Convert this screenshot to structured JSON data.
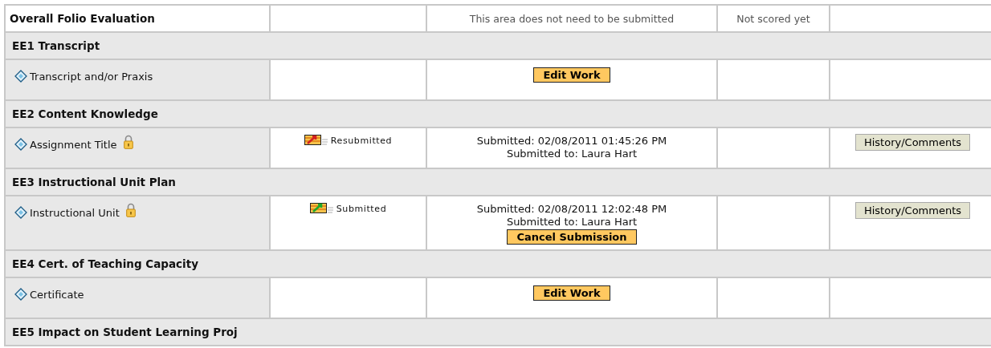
{
  "summary": {
    "title": "Overall Folio Evaluation",
    "status": "This area does not need to be submitted",
    "score": "Not scored yet"
  },
  "sections": [
    {
      "title": "EE1 Transcript",
      "items": [
        {
          "name": "Transcript and/or Praxis",
          "locked": false,
          "work": {
            "button": {
              "label": "Edit Work"
            }
          }
        }
      ]
    },
    {
      "title": "EE2 Content Knowledge",
      "items": [
        {
          "name": "Assignment Title",
          "locked": true,
          "status": {
            "kind": "resubmitted",
            "label": "Resubmitted"
          },
          "work": {
            "lines": [
              "Submitted: 02/08/2011 01:45:26 PM",
              "Submitted to: Laura Hart"
            ]
          },
          "history_button": "History/Comments"
        }
      ]
    },
    {
      "title": "EE3 Instructional Unit Plan",
      "items": [
        {
          "name": "Instructional Unit",
          "locked": true,
          "status": {
            "kind": "submitted",
            "label": "Submitted"
          },
          "work": {
            "lines": [
              "Submitted: 02/08/2011 12:02:48 PM",
              "Submitted to: Laura Hart"
            ],
            "button": {
              "label": "Cancel Submission"
            }
          },
          "history_button": "History/Comments"
        }
      ]
    },
    {
      "title": "EE4 Cert. of Teaching Capacity",
      "items": [
        {
          "name": "Certificate",
          "locked": false,
          "work": {
            "button": {
              "label": "Edit Work"
            }
          }
        }
      ]
    },
    {
      "title": "EE5 Impact on Student Learning Proj"
    }
  ]
}
